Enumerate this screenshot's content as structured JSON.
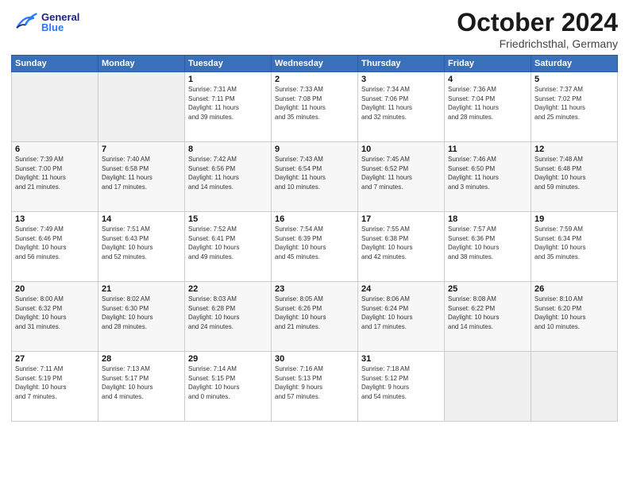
{
  "header": {
    "logo_general": "General",
    "logo_blue": "Blue",
    "month_title": "October 2024",
    "location": "Friedrichsthal, Germany"
  },
  "days_of_week": [
    "Sunday",
    "Monday",
    "Tuesday",
    "Wednesday",
    "Thursday",
    "Friday",
    "Saturday"
  ],
  "weeks": [
    [
      {
        "day": "",
        "info": ""
      },
      {
        "day": "",
        "info": ""
      },
      {
        "day": "1",
        "info": "Sunrise: 7:31 AM\nSunset: 7:11 PM\nDaylight: 11 hours\nand 39 minutes."
      },
      {
        "day": "2",
        "info": "Sunrise: 7:33 AM\nSunset: 7:08 PM\nDaylight: 11 hours\nand 35 minutes."
      },
      {
        "day": "3",
        "info": "Sunrise: 7:34 AM\nSunset: 7:06 PM\nDaylight: 11 hours\nand 32 minutes."
      },
      {
        "day": "4",
        "info": "Sunrise: 7:36 AM\nSunset: 7:04 PM\nDaylight: 11 hours\nand 28 minutes."
      },
      {
        "day": "5",
        "info": "Sunrise: 7:37 AM\nSunset: 7:02 PM\nDaylight: 11 hours\nand 25 minutes."
      }
    ],
    [
      {
        "day": "6",
        "info": "Sunrise: 7:39 AM\nSunset: 7:00 PM\nDaylight: 11 hours\nand 21 minutes."
      },
      {
        "day": "7",
        "info": "Sunrise: 7:40 AM\nSunset: 6:58 PM\nDaylight: 11 hours\nand 17 minutes."
      },
      {
        "day": "8",
        "info": "Sunrise: 7:42 AM\nSunset: 6:56 PM\nDaylight: 11 hours\nand 14 minutes."
      },
      {
        "day": "9",
        "info": "Sunrise: 7:43 AM\nSunset: 6:54 PM\nDaylight: 11 hours\nand 10 minutes."
      },
      {
        "day": "10",
        "info": "Sunrise: 7:45 AM\nSunset: 6:52 PM\nDaylight: 11 hours\nand 7 minutes."
      },
      {
        "day": "11",
        "info": "Sunrise: 7:46 AM\nSunset: 6:50 PM\nDaylight: 11 hours\nand 3 minutes."
      },
      {
        "day": "12",
        "info": "Sunrise: 7:48 AM\nSunset: 6:48 PM\nDaylight: 10 hours\nand 59 minutes."
      }
    ],
    [
      {
        "day": "13",
        "info": "Sunrise: 7:49 AM\nSunset: 6:46 PM\nDaylight: 10 hours\nand 56 minutes."
      },
      {
        "day": "14",
        "info": "Sunrise: 7:51 AM\nSunset: 6:43 PM\nDaylight: 10 hours\nand 52 minutes."
      },
      {
        "day": "15",
        "info": "Sunrise: 7:52 AM\nSunset: 6:41 PM\nDaylight: 10 hours\nand 49 minutes."
      },
      {
        "day": "16",
        "info": "Sunrise: 7:54 AM\nSunset: 6:39 PM\nDaylight: 10 hours\nand 45 minutes."
      },
      {
        "day": "17",
        "info": "Sunrise: 7:55 AM\nSunset: 6:38 PM\nDaylight: 10 hours\nand 42 minutes."
      },
      {
        "day": "18",
        "info": "Sunrise: 7:57 AM\nSunset: 6:36 PM\nDaylight: 10 hours\nand 38 minutes."
      },
      {
        "day": "19",
        "info": "Sunrise: 7:59 AM\nSunset: 6:34 PM\nDaylight: 10 hours\nand 35 minutes."
      }
    ],
    [
      {
        "day": "20",
        "info": "Sunrise: 8:00 AM\nSunset: 6:32 PM\nDaylight: 10 hours\nand 31 minutes."
      },
      {
        "day": "21",
        "info": "Sunrise: 8:02 AM\nSunset: 6:30 PM\nDaylight: 10 hours\nand 28 minutes."
      },
      {
        "day": "22",
        "info": "Sunrise: 8:03 AM\nSunset: 6:28 PM\nDaylight: 10 hours\nand 24 minutes."
      },
      {
        "day": "23",
        "info": "Sunrise: 8:05 AM\nSunset: 6:26 PM\nDaylight: 10 hours\nand 21 minutes."
      },
      {
        "day": "24",
        "info": "Sunrise: 8:06 AM\nSunset: 6:24 PM\nDaylight: 10 hours\nand 17 minutes."
      },
      {
        "day": "25",
        "info": "Sunrise: 8:08 AM\nSunset: 6:22 PM\nDaylight: 10 hours\nand 14 minutes."
      },
      {
        "day": "26",
        "info": "Sunrise: 8:10 AM\nSunset: 6:20 PM\nDaylight: 10 hours\nand 10 minutes."
      }
    ],
    [
      {
        "day": "27",
        "info": "Sunrise: 7:11 AM\nSunset: 5:19 PM\nDaylight: 10 hours\nand 7 minutes."
      },
      {
        "day": "28",
        "info": "Sunrise: 7:13 AM\nSunset: 5:17 PM\nDaylight: 10 hours\nand 4 minutes."
      },
      {
        "day": "29",
        "info": "Sunrise: 7:14 AM\nSunset: 5:15 PM\nDaylight: 10 hours\nand 0 minutes."
      },
      {
        "day": "30",
        "info": "Sunrise: 7:16 AM\nSunset: 5:13 PM\nDaylight: 9 hours\nand 57 minutes."
      },
      {
        "day": "31",
        "info": "Sunrise: 7:18 AM\nSunset: 5:12 PM\nDaylight: 9 hours\nand 54 minutes."
      },
      {
        "day": "",
        "info": ""
      },
      {
        "day": "",
        "info": ""
      }
    ]
  ]
}
